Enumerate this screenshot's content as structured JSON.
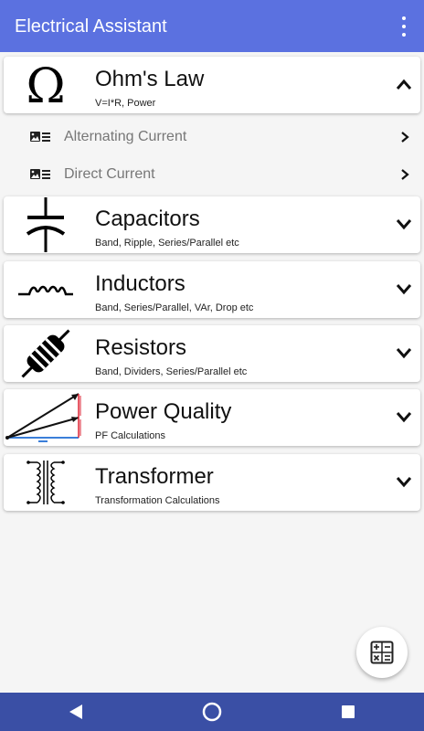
{
  "app_bar": {
    "title": "Electrical Assistant",
    "overflow_icon": "more-vert-icon",
    "color": "#5b71e0"
  },
  "sections": [
    {
      "id": "ohms-law",
      "title": "Ohm's Law",
      "subtitle": "V=I*R, Power",
      "icon": "omega-icon",
      "expanded": true
    },
    {
      "id": "capacitors",
      "title": "Capacitors",
      "subtitle": "Band, Ripple, Series/Parallel etc",
      "icon": "capacitor-symbol-icon",
      "expanded": false
    },
    {
      "id": "inductors",
      "title": "Inductors",
      "subtitle": "Band, Series/Parallel, VAr, Drop etc",
      "icon": "inductor-symbol-icon",
      "expanded": false
    },
    {
      "id": "resistors",
      "title": "Resistors",
      "subtitle": "Band, Dividers, Series/Parallel etc",
      "icon": "resistor-icon",
      "expanded": false
    },
    {
      "id": "power-quality",
      "title": "Power Quality",
      "subtitle": "PF Calculations",
      "icon": "power-triangle-icon",
      "expanded": false
    },
    {
      "id": "transformer",
      "title": "Transformer",
      "subtitle": "Transformation Calculations",
      "icon": "transformer-symbol-icon",
      "expanded": false
    }
  ],
  "ohms_law_items": [
    {
      "label": "Alternating Current",
      "icon": "list-image-icon"
    },
    {
      "label": "Direct Current",
      "icon": "list-image-icon"
    }
  ],
  "fab": {
    "icon": "calculator-icon"
  },
  "nav_bar": {
    "color": "#3a4fa5",
    "buttons": [
      "back-icon",
      "home-icon",
      "recents-icon"
    ]
  }
}
